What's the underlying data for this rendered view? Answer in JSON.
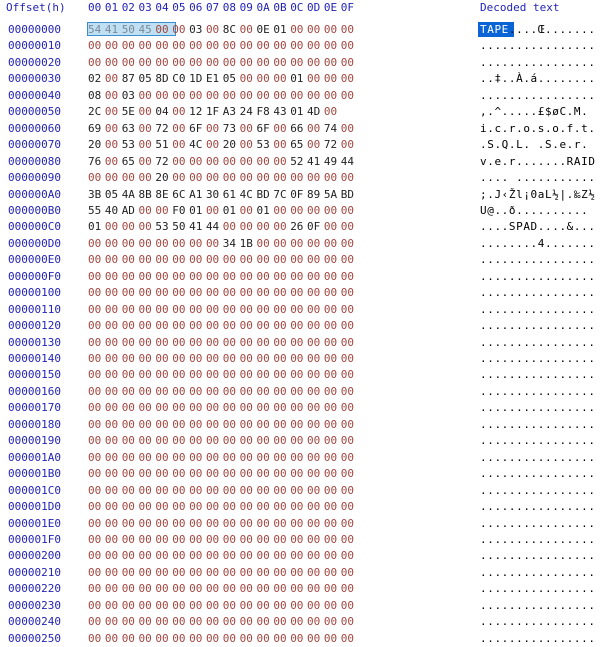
{
  "header": {
    "offset_label": "Offset(h)",
    "columns": [
      "00",
      "01",
      "02",
      "03",
      "04",
      "05",
      "06",
      "07",
      "08",
      "09",
      "0A",
      "0B",
      "0C",
      "0D",
      "0E",
      "0F"
    ],
    "decoded_label": "Decoded text"
  },
  "colors": {
    "header_blue": "#2323b8",
    "byte_normal": "#222222",
    "byte_zero": "#a2463f",
    "selection_fill": "#bfe0f2",
    "selection_border": "#3b8fd1",
    "text_selection": "#0a64d6"
  },
  "selection": {
    "start_offset": "00000000",
    "length": 4,
    "decoded": "TAPE"
  },
  "rows": [
    {
      "offset": "00000000",
      "bytes": [
        "54",
        "41",
        "50",
        "45",
        "00",
        "00",
        "03",
        "00",
        "8C",
        "00",
        "0E",
        "01",
        "00",
        "00",
        "00",
        "00"
      ],
      "text": "TAPE....Œ......."
    },
    {
      "offset": "00000010",
      "bytes": [
        "00",
        "00",
        "00",
        "00",
        "00",
        "00",
        "00",
        "00",
        "00",
        "00",
        "00",
        "00",
        "00",
        "00",
        "00",
        "00"
      ],
      "text": "................"
    },
    {
      "offset": "00000020",
      "bytes": [
        "00",
        "00",
        "00",
        "00",
        "00",
        "00",
        "00",
        "00",
        "00",
        "00",
        "00",
        "00",
        "00",
        "00",
        "00",
        "00"
      ],
      "text": "................"
    },
    {
      "offset": "00000030",
      "bytes": [
        "02",
        "00",
        "87",
        "05",
        "8D",
        "C0",
        "1D",
        "E1",
        "05",
        "00",
        "00",
        "00",
        "01",
        "00",
        "00",
        "00"
      ],
      "text": "..‡..À.á........"
    },
    {
      "offset": "00000040",
      "bytes": [
        "08",
        "00",
        "03",
        "00",
        "00",
        "00",
        "00",
        "00",
        "00",
        "00",
        "00",
        "00",
        "00",
        "00",
        "00",
        "00"
      ],
      "text": "................"
    },
    {
      "offset": "00000050",
      "bytes": [
        "2C",
        "00",
        "5E",
        "00",
        "04",
        "00",
        "12",
        "1F",
        "A3",
        "24",
        "F8",
        "43",
        "01",
        "4D",
        "00"
      ],
      "text": ",.^.....£$øC.M."
    },
    {
      "offset": "00000060",
      "bytes": [
        "69",
        "00",
        "63",
        "00",
        "72",
        "00",
        "6F",
        "00",
        "73",
        "00",
        "6F",
        "00",
        "66",
        "00",
        "74",
        "00"
      ],
      "text": "i.c.r.o.s.o.f.t."
    },
    {
      "offset": "00000070",
      "bytes": [
        "20",
        "00",
        "53",
        "00",
        "51",
        "00",
        "4C",
        "00",
        "20",
        "00",
        "53",
        "00",
        "65",
        "00",
        "72",
        "00"
      ],
      "text": " .S.Q.L. .S.e.r."
    },
    {
      "offset": "00000080",
      "bytes": [
        "76",
        "00",
        "65",
        "00",
        "72",
        "00",
        "00",
        "00",
        "00",
        "00",
        "00",
        "00",
        "52",
        "41",
        "49",
        "44"
      ],
      "text": "v.e.r.......RAID"
    },
    {
      "offset": "00000090",
      "bytes": [
        "00",
        "00",
        "00",
        "00",
        "20",
        "00",
        "00",
        "00",
        "00",
        "00",
        "00",
        "00",
        "00",
        "00",
        "00",
        "00"
      ],
      "text": ".... ..........."
    },
    {
      "offset": "000000A0",
      "bytes": [
        "3B",
        "05",
        "4A",
        "8B",
        "8E",
        "6C",
        "A1",
        "30",
        "61",
        "4C",
        "BD",
        "7C",
        "0F",
        "89",
        "5A",
        "BD"
      ],
      "text": ";.J‹Žl¡0aL½|.‰Z½"
    },
    {
      "offset": "000000B0",
      "bytes": [
        "55",
        "40",
        "AD",
        "00",
        "00",
        "F0",
        "01",
        "00",
        "01",
        "00",
        "01",
        "00",
        "00",
        "00",
        "00",
        "00"
      ],
      "text": "U@­..ð.........."
    },
    {
      "offset": "000000C0",
      "bytes": [
        "01",
        "00",
        "00",
        "00",
        "53",
        "50",
        "41",
        "44",
        "00",
        "00",
        "00",
        "00",
        "26",
        "0F",
        "00",
        "00"
      ],
      "text": "....SPAD....&..."
    },
    {
      "offset": "000000D0",
      "bytes": [
        "00",
        "00",
        "00",
        "00",
        "00",
        "00",
        "00",
        "00",
        "34",
        "1B",
        "00",
        "00",
        "00",
        "00",
        "00",
        "00"
      ],
      "text": "........4......."
    },
    {
      "offset": "000000E0",
      "bytes": [
        "00",
        "00",
        "00",
        "00",
        "00",
        "00",
        "00",
        "00",
        "00",
        "00",
        "00",
        "00",
        "00",
        "00",
        "00",
        "00"
      ],
      "text": "................"
    },
    {
      "offset": "000000F0",
      "bytes": [
        "00",
        "00",
        "00",
        "00",
        "00",
        "00",
        "00",
        "00",
        "00",
        "00",
        "00",
        "00",
        "00",
        "00",
        "00",
        "00"
      ],
      "text": "................"
    },
    {
      "offset": "00000100",
      "bytes": [
        "00",
        "00",
        "00",
        "00",
        "00",
        "00",
        "00",
        "00",
        "00",
        "00",
        "00",
        "00",
        "00",
        "00",
        "00",
        "00"
      ],
      "text": "................"
    },
    {
      "offset": "00000110",
      "bytes": [
        "00",
        "00",
        "00",
        "00",
        "00",
        "00",
        "00",
        "00",
        "00",
        "00",
        "00",
        "00",
        "00",
        "00",
        "00",
        "00"
      ],
      "text": "................"
    },
    {
      "offset": "00000120",
      "bytes": [
        "00",
        "00",
        "00",
        "00",
        "00",
        "00",
        "00",
        "00",
        "00",
        "00",
        "00",
        "00",
        "00",
        "00",
        "00",
        "00"
      ],
      "text": "................"
    },
    {
      "offset": "00000130",
      "bytes": [
        "00",
        "00",
        "00",
        "00",
        "00",
        "00",
        "00",
        "00",
        "00",
        "00",
        "00",
        "00",
        "00",
        "00",
        "00",
        "00"
      ],
      "text": "................"
    },
    {
      "offset": "00000140",
      "bytes": [
        "00",
        "00",
        "00",
        "00",
        "00",
        "00",
        "00",
        "00",
        "00",
        "00",
        "00",
        "00",
        "00",
        "00",
        "00",
        "00"
      ],
      "text": "................"
    },
    {
      "offset": "00000150",
      "bytes": [
        "00",
        "00",
        "00",
        "00",
        "00",
        "00",
        "00",
        "00",
        "00",
        "00",
        "00",
        "00",
        "00",
        "00",
        "00",
        "00"
      ],
      "text": "................"
    },
    {
      "offset": "00000160",
      "bytes": [
        "00",
        "00",
        "00",
        "00",
        "00",
        "00",
        "00",
        "00",
        "00",
        "00",
        "00",
        "00",
        "00",
        "00",
        "00",
        "00"
      ],
      "text": "................"
    },
    {
      "offset": "00000170",
      "bytes": [
        "00",
        "00",
        "00",
        "00",
        "00",
        "00",
        "00",
        "00",
        "00",
        "00",
        "00",
        "00",
        "00",
        "00",
        "00",
        "00"
      ],
      "text": "................"
    },
    {
      "offset": "00000180",
      "bytes": [
        "00",
        "00",
        "00",
        "00",
        "00",
        "00",
        "00",
        "00",
        "00",
        "00",
        "00",
        "00",
        "00",
        "00",
        "00",
        "00"
      ],
      "text": "................"
    },
    {
      "offset": "00000190",
      "bytes": [
        "00",
        "00",
        "00",
        "00",
        "00",
        "00",
        "00",
        "00",
        "00",
        "00",
        "00",
        "00",
        "00",
        "00",
        "00",
        "00"
      ],
      "text": "................"
    },
    {
      "offset": "000001A0",
      "bytes": [
        "00",
        "00",
        "00",
        "00",
        "00",
        "00",
        "00",
        "00",
        "00",
        "00",
        "00",
        "00",
        "00",
        "00",
        "00",
        "00"
      ],
      "text": "................"
    },
    {
      "offset": "000001B0",
      "bytes": [
        "00",
        "00",
        "00",
        "00",
        "00",
        "00",
        "00",
        "00",
        "00",
        "00",
        "00",
        "00",
        "00",
        "00",
        "00",
        "00"
      ],
      "text": "................"
    },
    {
      "offset": "000001C0",
      "bytes": [
        "00",
        "00",
        "00",
        "00",
        "00",
        "00",
        "00",
        "00",
        "00",
        "00",
        "00",
        "00",
        "00",
        "00",
        "00",
        "00"
      ],
      "text": "................"
    },
    {
      "offset": "000001D0",
      "bytes": [
        "00",
        "00",
        "00",
        "00",
        "00",
        "00",
        "00",
        "00",
        "00",
        "00",
        "00",
        "00",
        "00",
        "00",
        "00",
        "00"
      ],
      "text": "................"
    },
    {
      "offset": "000001E0",
      "bytes": [
        "00",
        "00",
        "00",
        "00",
        "00",
        "00",
        "00",
        "00",
        "00",
        "00",
        "00",
        "00",
        "00",
        "00",
        "00",
        "00"
      ],
      "text": "................"
    },
    {
      "offset": "000001F0",
      "bytes": [
        "00",
        "00",
        "00",
        "00",
        "00",
        "00",
        "00",
        "00",
        "00",
        "00",
        "00",
        "00",
        "00",
        "00",
        "00",
        "00"
      ],
      "text": "................"
    },
    {
      "offset": "00000200",
      "bytes": [
        "00",
        "00",
        "00",
        "00",
        "00",
        "00",
        "00",
        "00",
        "00",
        "00",
        "00",
        "00",
        "00",
        "00",
        "00",
        "00"
      ],
      "text": "................"
    },
    {
      "offset": "00000210",
      "bytes": [
        "00",
        "00",
        "00",
        "00",
        "00",
        "00",
        "00",
        "00",
        "00",
        "00",
        "00",
        "00",
        "00",
        "00",
        "00",
        "00"
      ],
      "text": "................"
    },
    {
      "offset": "00000220",
      "bytes": [
        "00",
        "00",
        "00",
        "00",
        "00",
        "00",
        "00",
        "00",
        "00",
        "00",
        "00",
        "00",
        "00",
        "00",
        "00",
        "00"
      ],
      "text": "................"
    },
    {
      "offset": "00000230",
      "bytes": [
        "00",
        "00",
        "00",
        "00",
        "00",
        "00",
        "00",
        "00",
        "00",
        "00",
        "00",
        "00",
        "00",
        "00",
        "00",
        "00"
      ],
      "text": "................"
    },
    {
      "offset": "00000240",
      "bytes": [
        "00",
        "00",
        "00",
        "00",
        "00",
        "00",
        "00",
        "00",
        "00",
        "00",
        "00",
        "00",
        "00",
        "00",
        "00",
        "00"
      ],
      "text": "................"
    },
    {
      "offset": "00000250",
      "bytes": [
        "00",
        "00",
        "00",
        "00",
        "00",
        "00",
        "00",
        "00",
        "00",
        "00",
        "00",
        "00",
        "00",
        "00",
        "00",
        "00"
      ],
      "text": "................"
    }
  ]
}
